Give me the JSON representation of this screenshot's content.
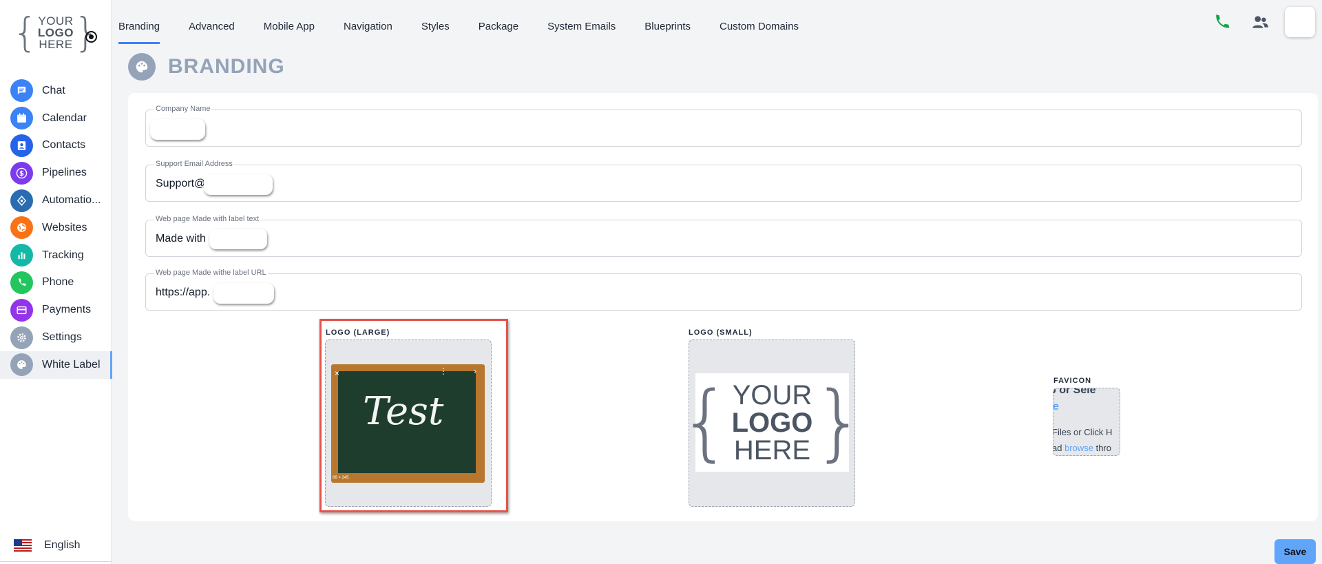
{
  "sidebar": {
    "logo": {
      "line1": "YOUR",
      "line2": "LOGO",
      "line3": "HERE"
    },
    "items": [
      {
        "label": "Chat",
        "icon": "chat-icon",
        "color": "#3b82f6"
      },
      {
        "label": "Calendar",
        "icon": "calendar-icon",
        "color": "#3b82f6"
      },
      {
        "label": "Contacts",
        "icon": "contacts-icon",
        "color": "#2563eb"
      },
      {
        "label": "Pipelines",
        "icon": "dollar-icon",
        "color": "#7c3aed"
      },
      {
        "label": "Automatio...",
        "icon": "automation-icon",
        "color": "#2b6cb0"
      },
      {
        "label": "Websites",
        "icon": "globe-icon",
        "color": "#f97316"
      },
      {
        "label": "Tracking",
        "icon": "bar-chart-icon",
        "color": "#14b8a6"
      },
      {
        "label": "Phone",
        "icon": "phone-icon",
        "color": "#22c55e"
      },
      {
        "label": "Payments",
        "icon": "card-icon",
        "color": "#9333ea"
      },
      {
        "label": "Settings",
        "icon": "gear-icon",
        "color": "#94a3b8"
      },
      {
        "label": "White Label",
        "icon": "palette-icon",
        "color": "#94a3b8",
        "active": true
      }
    ],
    "language": "English"
  },
  "tabs": [
    {
      "label": "Branding",
      "active": true
    },
    {
      "label": "Advanced"
    },
    {
      "label": "Mobile App"
    },
    {
      "label": "Navigation"
    },
    {
      "label": "Styles"
    },
    {
      "label": "Package"
    },
    {
      "label": "System Emails"
    },
    {
      "label": "Blueprints"
    },
    {
      "label": "Custom Domains"
    }
  ],
  "page": {
    "title": "BRANDING"
  },
  "form": {
    "company_name": {
      "label": "Company Name",
      "value": ""
    },
    "support_email": {
      "label": "Support Email Address",
      "value": "Support@"
    },
    "made_with_text": {
      "label": "Web page Made with label text",
      "value": "Made with"
    },
    "made_with_url": {
      "label": "Web page Made withe label URL",
      "value": "https://app."
    }
  },
  "uploads": {
    "logo_large": {
      "label": "LOGO (LARGE)",
      "image_text": "Test",
      "close": "×",
      "more": "⋮",
      "next": "›",
      "size": "66 × 245"
    },
    "logo_small": {
      "label": "LOGO (SMALL)",
      "image_line1": "YOUR",
      "image_line2": "LOGO",
      "image_line3": "HERE"
    },
    "favicon": {
      "label": "FAVICON",
      "line1": "p or Sele",
      "line2": "e",
      "line3": "Files or Click H",
      "line4_pre": "ad ",
      "line4_link": "browse",
      "line4_post": " thro"
    }
  },
  "actions": {
    "save": "Save"
  },
  "colors": {
    "accent": "#3b82f6",
    "save": "#60a5fa",
    "highlight": "#e5534b",
    "phone": "#16a34a"
  }
}
